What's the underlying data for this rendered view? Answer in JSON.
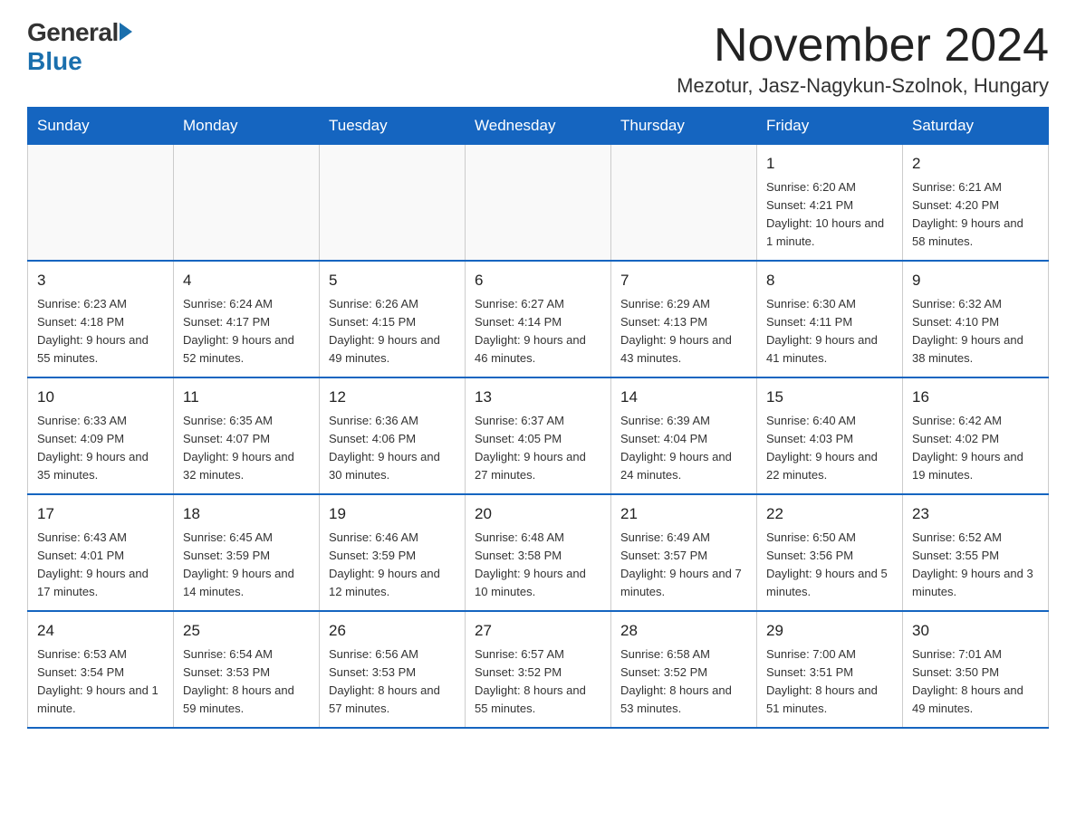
{
  "header": {
    "logo_general": "General",
    "logo_blue": "Blue",
    "month_title": "November 2024",
    "location": "Mezotur, Jasz-Nagykun-Szolnok, Hungary"
  },
  "calendar": {
    "days_of_week": [
      "Sunday",
      "Monday",
      "Tuesday",
      "Wednesday",
      "Thursday",
      "Friday",
      "Saturday"
    ],
    "weeks": [
      [
        {
          "day": "",
          "info": ""
        },
        {
          "day": "",
          "info": ""
        },
        {
          "day": "",
          "info": ""
        },
        {
          "day": "",
          "info": ""
        },
        {
          "day": "",
          "info": ""
        },
        {
          "day": "1",
          "info": "Sunrise: 6:20 AM\nSunset: 4:21 PM\nDaylight: 10 hours and 1 minute."
        },
        {
          "day": "2",
          "info": "Sunrise: 6:21 AM\nSunset: 4:20 PM\nDaylight: 9 hours and 58 minutes."
        }
      ],
      [
        {
          "day": "3",
          "info": "Sunrise: 6:23 AM\nSunset: 4:18 PM\nDaylight: 9 hours and 55 minutes."
        },
        {
          "day": "4",
          "info": "Sunrise: 6:24 AM\nSunset: 4:17 PM\nDaylight: 9 hours and 52 minutes."
        },
        {
          "day": "5",
          "info": "Sunrise: 6:26 AM\nSunset: 4:15 PM\nDaylight: 9 hours and 49 minutes."
        },
        {
          "day": "6",
          "info": "Sunrise: 6:27 AM\nSunset: 4:14 PM\nDaylight: 9 hours and 46 minutes."
        },
        {
          "day": "7",
          "info": "Sunrise: 6:29 AM\nSunset: 4:13 PM\nDaylight: 9 hours and 43 minutes."
        },
        {
          "day": "8",
          "info": "Sunrise: 6:30 AM\nSunset: 4:11 PM\nDaylight: 9 hours and 41 minutes."
        },
        {
          "day": "9",
          "info": "Sunrise: 6:32 AM\nSunset: 4:10 PM\nDaylight: 9 hours and 38 minutes."
        }
      ],
      [
        {
          "day": "10",
          "info": "Sunrise: 6:33 AM\nSunset: 4:09 PM\nDaylight: 9 hours and 35 minutes."
        },
        {
          "day": "11",
          "info": "Sunrise: 6:35 AM\nSunset: 4:07 PM\nDaylight: 9 hours and 32 minutes."
        },
        {
          "day": "12",
          "info": "Sunrise: 6:36 AM\nSunset: 4:06 PM\nDaylight: 9 hours and 30 minutes."
        },
        {
          "day": "13",
          "info": "Sunrise: 6:37 AM\nSunset: 4:05 PM\nDaylight: 9 hours and 27 minutes."
        },
        {
          "day": "14",
          "info": "Sunrise: 6:39 AM\nSunset: 4:04 PM\nDaylight: 9 hours and 24 minutes."
        },
        {
          "day": "15",
          "info": "Sunrise: 6:40 AM\nSunset: 4:03 PM\nDaylight: 9 hours and 22 minutes."
        },
        {
          "day": "16",
          "info": "Sunrise: 6:42 AM\nSunset: 4:02 PM\nDaylight: 9 hours and 19 minutes."
        }
      ],
      [
        {
          "day": "17",
          "info": "Sunrise: 6:43 AM\nSunset: 4:01 PM\nDaylight: 9 hours and 17 minutes."
        },
        {
          "day": "18",
          "info": "Sunrise: 6:45 AM\nSunset: 3:59 PM\nDaylight: 9 hours and 14 minutes."
        },
        {
          "day": "19",
          "info": "Sunrise: 6:46 AM\nSunset: 3:59 PM\nDaylight: 9 hours and 12 minutes."
        },
        {
          "day": "20",
          "info": "Sunrise: 6:48 AM\nSunset: 3:58 PM\nDaylight: 9 hours and 10 minutes."
        },
        {
          "day": "21",
          "info": "Sunrise: 6:49 AM\nSunset: 3:57 PM\nDaylight: 9 hours and 7 minutes."
        },
        {
          "day": "22",
          "info": "Sunrise: 6:50 AM\nSunset: 3:56 PM\nDaylight: 9 hours and 5 minutes."
        },
        {
          "day": "23",
          "info": "Sunrise: 6:52 AM\nSunset: 3:55 PM\nDaylight: 9 hours and 3 minutes."
        }
      ],
      [
        {
          "day": "24",
          "info": "Sunrise: 6:53 AM\nSunset: 3:54 PM\nDaylight: 9 hours and 1 minute."
        },
        {
          "day": "25",
          "info": "Sunrise: 6:54 AM\nSunset: 3:53 PM\nDaylight: 8 hours and 59 minutes."
        },
        {
          "day": "26",
          "info": "Sunrise: 6:56 AM\nSunset: 3:53 PM\nDaylight: 8 hours and 57 minutes."
        },
        {
          "day": "27",
          "info": "Sunrise: 6:57 AM\nSunset: 3:52 PM\nDaylight: 8 hours and 55 minutes."
        },
        {
          "day": "28",
          "info": "Sunrise: 6:58 AM\nSunset: 3:52 PM\nDaylight: 8 hours and 53 minutes."
        },
        {
          "day": "29",
          "info": "Sunrise: 7:00 AM\nSunset: 3:51 PM\nDaylight: 8 hours and 51 minutes."
        },
        {
          "day": "30",
          "info": "Sunrise: 7:01 AM\nSunset: 3:50 PM\nDaylight: 8 hours and 49 minutes."
        }
      ]
    ]
  }
}
